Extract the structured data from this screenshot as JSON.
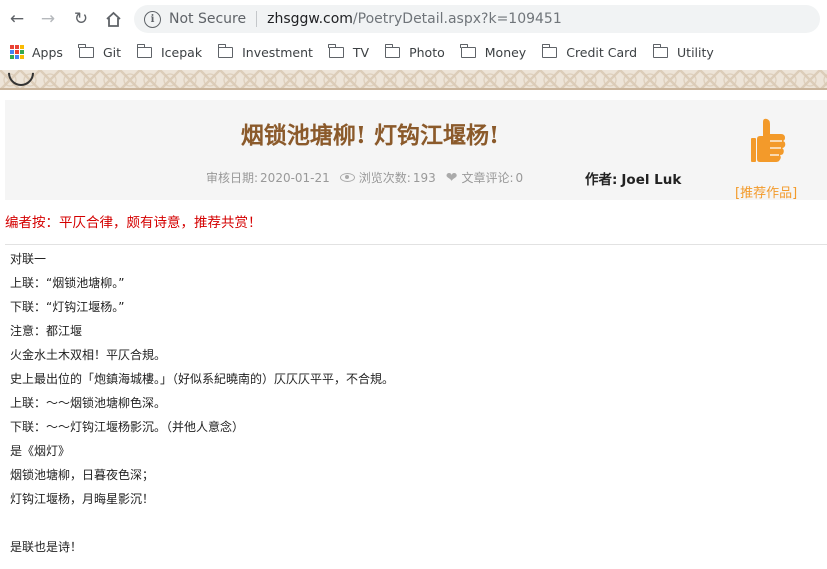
{
  "browser": {
    "security_label": "Not Secure",
    "url_host": "zhsggw.com",
    "url_path": "/PoetryDetail.aspx?k=109451",
    "bookmarks": [
      {
        "label": "Apps",
        "icon": "apps-grid-icon"
      },
      {
        "label": "Git",
        "icon": "folder-icon"
      },
      {
        "label": "Icepak",
        "icon": "folder-icon"
      },
      {
        "label": "Investment",
        "icon": "folder-icon"
      },
      {
        "label": "TV",
        "icon": "folder-icon"
      },
      {
        "label": "Photo",
        "icon": "folder-icon"
      },
      {
        "label": "Money",
        "icon": "folder-icon"
      },
      {
        "label": "Credit Card",
        "icon": "folder-icon"
      },
      {
        "label": "Utility",
        "icon": "folder-icon"
      }
    ]
  },
  "article": {
    "title": "烟锁池塘柳! 灯钩江堰杨!",
    "review_date_label": "审核日期:",
    "review_date": "2020-01-21",
    "views_label": "浏览次数:",
    "views": "193",
    "comments_label": "文章评论:",
    "comments": "0",
    "author_label": "作者:",
    "author": "Joel Luk",
    "recommend_label": "[推荐作品]",
    "editor_note": "编者按：平仄合律，颇有诗意，推荐共赏！",
    "lines": [
      "对联一",
      "上联：“烟锁池塘柳。”",
      "下联：“灯钩江堰杨。”",
      "注意：都江堰",
      "火金水土木双相！平仄合規。",
      "史上最出位的「炮鎮海城樓。」（好似系紀曉南的）仄仄仄平平，不合規。",
      "上联：～～烟锁池塘柳色深。",
      "下联：～～灯钩江堰杨影沉。（并他人意念）",
      "是《烟灯》",
      "烟锁池塘柳，日暮夜色深；",
      "灯钩江堰杨，月晦星影沉！",
      "",
      "是联也是诗！"
    ]
  },
  "colors": {
    "title": "#8b5a2b",
    "editor_note": "#d40000",
    "recommend": "#f39a2a"
  }
}
